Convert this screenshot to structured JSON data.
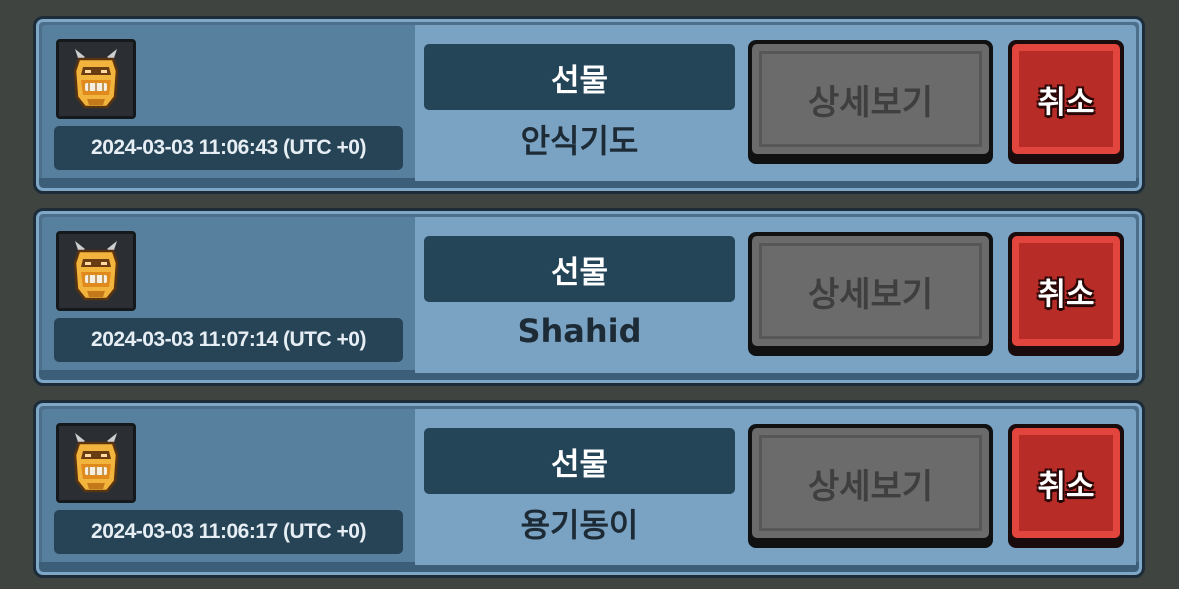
{
  "screen": "gift-request-list",
  "colors": {
    "background": "#3f4440",
    "card_bg": "#4c6f8c",
    "type_label_bg": "#244458",
    "detail_button": "#6b6b6b",
    "cancel_button": "#e2453d"
  },
  "entries": [
    {
      "icon": "armored-warrior-helmet-icon",
      "timestamp": "2024-03-03 11:06:43 (UTC +0)",
      "type": "선물",
      "name": "안식기도",
      "detail_label": "상세보기",
      "cancel_label": "취소"
    },
    {
      "icon": "armored-warrior-helmet-icon",
      "timestamp": "2024-03-03 11:07:14 (UTC +0)",
      "type": "선물",
      "name": "Shahid",
      "detail_label": "상세보기",
      "cancel_label": "취소"
    },
    {
      "icon": "armored-warrior-helmet-icon",
      "timestamp": "2024-03-03 11:06:17 (UTC +0)",
      "type": "선물",
      "name": "용기동이",
      "detail_label": "상세보기",
      "cancel_label": "취소"
    }
  ]
}
